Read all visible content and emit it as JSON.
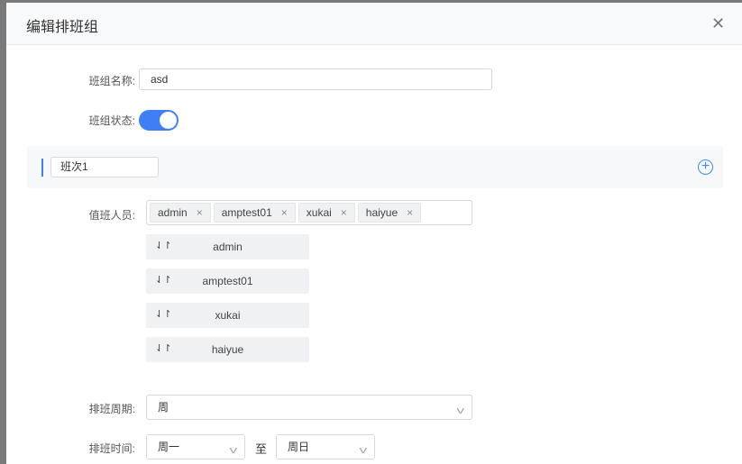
{
  "modal": {
    "title": "编辑排班组"
  },
  "form": {
    "name_label": "班组名称:",
    "name_value": "asd",
    "status_label": "班组状态:",
    "status_on": true,
    "shift_name": "班次1",
    "staff_label": "值班人员:",
    "staff": [
      "admin",
      "amptest01",
      "xukai",
      "haiyue"
    ],
    "cycle_label": "排班周期:",
    "cycle_value": "周",
    "time_label": "排班时间:",
    "time_from": "周一",
    "time_sep": "至",
    "time_to": "周日"
  },
  "icons": {
    "close": "close-icon",
    "add": "plus-circle-icon",
    "drag": "sort-icon",
    "dropdown": "chevron-down-icon",
    "tag_remove": "close-icon"
  },
  "colors": {
    "accent": "#3f7ff5"
  }
}
